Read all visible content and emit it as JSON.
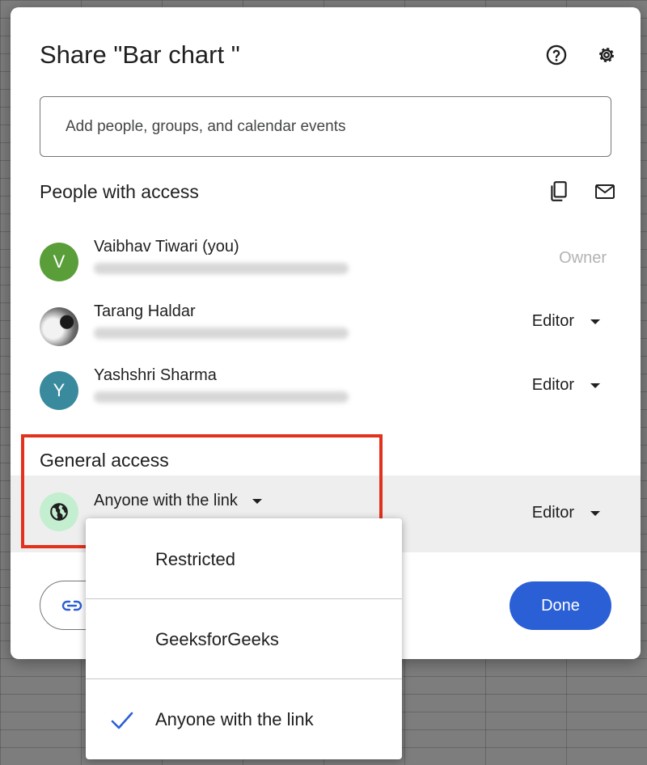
{
  "dialog": {
    "title": "Share \"Bar chart \"",
    "help_icon": "help-icon",
    "settings_icon": "gear-icon",
    "add_people_placeholder": "Add people, groups, and calendar events"
  },
  "people_section": {
    "title": "People with access",
    "copy_icon": "copy-icon",
    "email_icon": "mail-icon",
    "people": [
      {
        "name": "Vaibhav Tiwari (you)",
        "initial": "V",
        "avatar_color": "#5a9e3a",
        "role": "Owner"
      },
      {
        "name": "Tarang Haldar",
        "initial": "",
        "avatar_color": "#8a8a8a",
        "role": "Editor"
      },
      {
        "name": "Yashshri Sharma",
        "initial": "Y",
        "avatar_color": "#3a8a9e",
        "role": "Editor"
      }
    ]
  },
  "general_access": {
    "title": "General access",
    "selected": "Anyone with the link",
    "role": "Editor",
    "globe_icon": "globe-icon"
  },
  "footer": {
    "copy_link_icon": "link-icon",
    "done_label": "Done"
  },
  "dropdown": {
    "options": [
      {
        "label": "Restricted",
        "checked": false
      },
      {
        "label": "GeeksforGeeks",
        "checked": false
      },
      {
        "label": "Anyone with the link",
        "checked": true
      }
    ]
  },
  "colors": {
    "primary": "#2b5fd6",
    "highlight": "#e2311d",
    "check": "#2b5fd6"
  }
}
